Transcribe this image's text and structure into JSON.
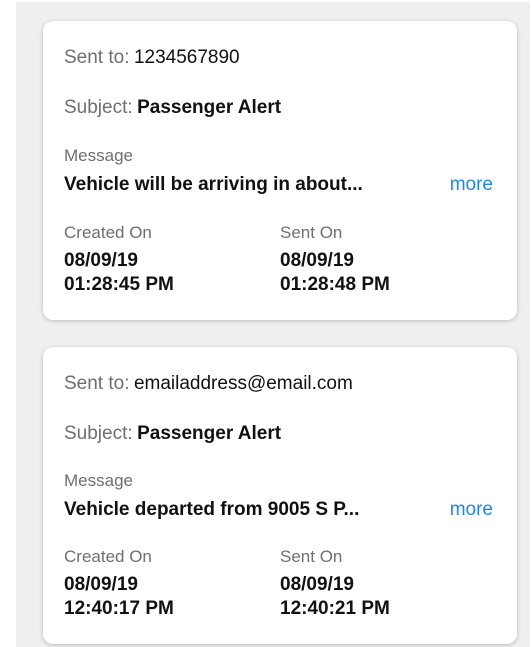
{
  "messages": [
    {
      "sent_to_label": "Sent to:",
      "sent_to_value": "1234567890",
      "subject_label": "Subject:",
      "subject_value": "Passenger Alert",
      "message_label": "Message",
      "message_text": "Vehicle will be arriving in about...",
      "more_label": "more",
      "created_label": "Created On",
      "created_date": "08/09/19",
      "created_time": "01:28:45 PM",
      "sent_label": "Sent On",
      "sent_date": "08/09/19",
      "sent_time": "01:28:48 PM"
    },
    {
      "sent_to_label": "Sent to:",
      "sent_to_value": "emailaddress@email.com",
      "subject_label": "Subject:",
      "subject_value": "Passenger Alert",
      "message_label": "Message",
      "message_text": "Vehicle departed from 9005 S P...",
      "more_label": "more",
      "created_label": "Created On",
      "created_date": "08/09/19",
      "created_time": "12:40:17 PM",
      "sent_label": "Sent On",
      "sent_date": "08/09/19",
      "sent_time": "12:40:21 PM"
    }
  ],
  "colors": {
    "background": "#efefef",
    "card": "#ffffff",
    "link": "#1e88e5",
    "label": "#6f6f6f",
    "text": "#111111"
  }
}
